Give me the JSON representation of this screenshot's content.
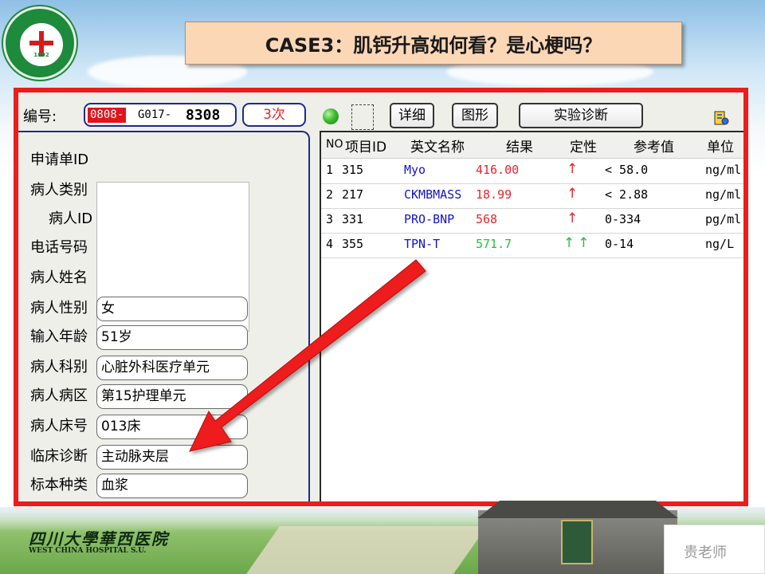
{
  "slide": {
    "title": "CASE3：肌钙升高如何看？是心梗吗？",
    "logo_text": "1892",
    "footer_logo_cn": "四川大學華西医院",
    "footer_logo_en": "WEST CHINA HOSPITAL S.U.",
    "watermark": "贵老师"
  },
  "app": {
    "id_label": "编号:",
    "id_prefix": "0808-",
    "id_mid": "G017-",
    "id_number": "8308",
    "count": "3次",
    "buttons": {
      "detail": "详细",
      "graph": "图形",
      "diagnosis": "实验诊断"
    },
    "patient": {
      "labels": {
        "request_id": "申请单ID",
        "patient_type": "病人类别",
        "patient_id": "病人ID",
        "phone": "电话号码",
        "name": "病人姓名",
        "sex": "病人性别",
        "age": "输入年龄",
        "department": "病人科别",
        "ward": "病人病区",
        "bed": "病人床号",
        "diagnosis": "临床诊断",
        "specimen": "标本种类"
      },
      "values": {
        "sex": "女",
        "age": "51岁",
        "department": "心脏外科医疗单元",
        "ward": "第15护理单元",
        "bed": "013床",
        "diagnosis": "主动脉夹层",
        "specimen": "血浆"
      }
    },
    "table": {
      "headers": {
        "no": "NO",
        "item_id": "项目ID",
        "name_en": "英文名称",
        "result": "结果",
        "flag": "定性",
        "reference": "参考值",
        "unit": "单位"
      },
      "rows": [
        {
          "no": "1",
          "item_id": "315",
          "name_en": "Myo",
          "result": "416.00",
          "flag": "↑",
          "reference": "< 58.0",
          "unit": "ng/ml"
        },
        {
          "no": "2",
          "item_id": "217",
          "name_en": "CKMBMASS",
          "result": "18.99",
          "flag": "↑",
          "reference": "< 2.88",
          "unit": "ng/ml"
        },
        {
          "no": "3",
          "item_id": "331",
          "name_en": "PRO-BNP",
          "result": "568",
          "flag": "↑",
          "reference": "0-334",
          "unit": "pg/ml"
        },
        {
          "no": "4",
          "item_id": "355",
          "name_en": "TPN-T",
          "result": "571.7",
          "flag": "↑↑",
          "reference": "0-14",
          "unit": "ng/L"
        }
      ]
    }
  },
  "colors": {
    "frame": "#ee1c1c",
    "title_bg": "#fcd7b6",
    "name_blue": "#1414c8",
    "result_red": "#e8242a",
    "result_green": "#22c23a",
    "flag_red": "#e8242a",
    "flag_green": "#22c23a"
  }
}
